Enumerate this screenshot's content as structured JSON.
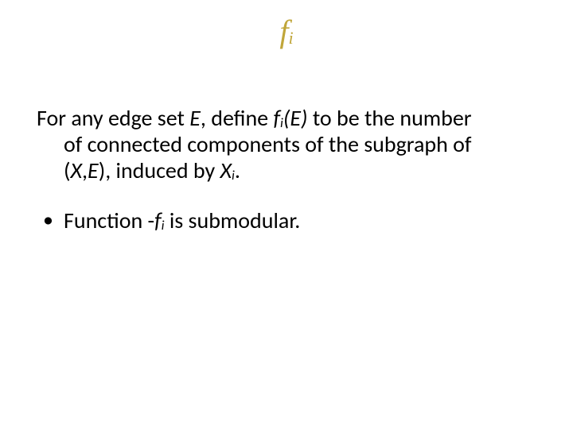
{
  "title": {
    "base": "f",
    "sub": "i"
  },
  "def": {
    "t1": "For any edge set ",
    "E1": "E",
    "t2": ", define ",
    "fiE_f": "f",
    "fiE_i": "i",
    "fiE_paren": "(E)",
    "t3": " to be the number",
    "t4": "of connected components of the subgraph of",
    "XE_open": "(",
    "XE_X": "X",
    "XE_comma": ",",
    "XE_E": "E",
    "XE_close": ")",
    "t5": ", induced by ",
    "Xi_X": "X",
    "Xi_i": "i",
    "t6": "."
  },
  "bullet": {
    "dot": "•",
    "t1": "Function -",
    "f": "f",
    "i": "i",
    "t2": "  is submodular."
  }
}
